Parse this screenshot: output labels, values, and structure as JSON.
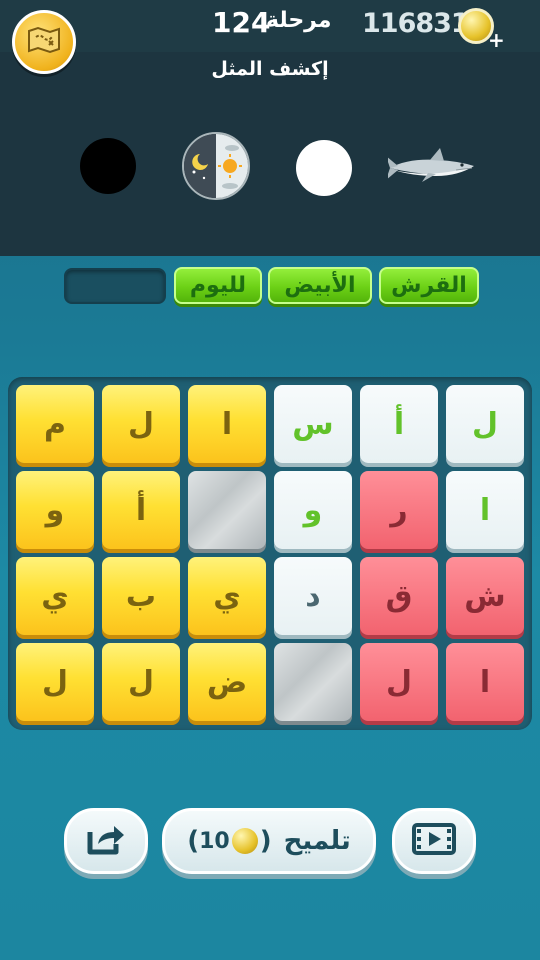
{
  "header": {
    "coins": "1168313",
    "plus": "+",
    "level_label": "مرحلة",
    "level_number": "124"
  },
  "clue": {
    "instruction": "إكشف المثل"
  },
  "answer": {
    "words": [
      "القرش",
      "الأبيض",
      "لليوم"
    ]
  },
  "tiles": [
    [
      "م",
      "ل",
      "ا",
      "س",
      "أ",
      "ل"
    ],
    [
      "و",
      "أ",
      "",
      "و",
      "ر",
      "ا"
    ],
    [
      "ي",
      "ب",
      "ي",
      "د",
      "ق",
      "ش"
    ],
    [
      "ل",
      "ل",
      "ض",
      "",
      "ل",
      "ا"
    ]
  ],
  "tile_colors": [
    [
      "yellow",
      "yellow",
      "yellow",
      "white",
      "white",
      "white"
    ],
    [
      "yellow",
      "yellow",
      "stone",
      "white",
      "red",
      "white"
    ],
    [
      "yellow",
      "yellow",
      "yellow",
      "white",
      "red",
      "red"
    ],
    [
      "yellow",
      "yellow",
      "yellow",
      "stone",
      "red",
      "red"
    ]
  ],
  "hint_button": {
    "label": "تلميح",
    "cost": "10",
    "open_paren": "(",
    "close_paren": ")"
  },
  "colors": {
    "answer_green": "#6cd116",
    "tile_yellow": "#ffe033",
    "tile_red": "#f2636f",
    "tile_white": "#eef5f7"
  },
  "icons": {
    "map": "treasure-map-icon",
    "coin": "coin-icon",
    "share": "share-icon",
    "video": "video-ad-icon"
  }
}
